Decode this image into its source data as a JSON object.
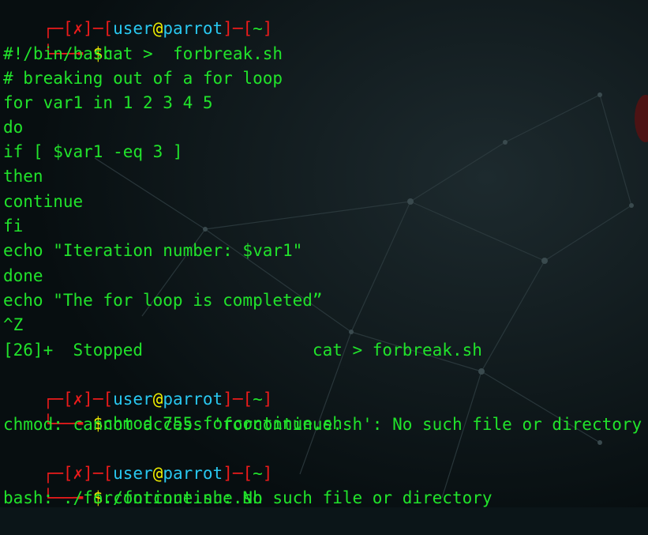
{
  "prompts": [
    {
      "user": "user",
      "at": "@",
      "host": "parrot",
      "dir": "~",
      "status_mark": "✗",
      "dollar": "$",
      "command": "cat >  forbreak.sh"
    },
    {
      "user": "user",
      "at": "@",
      "host": "parrot",
      "dir": "~",
      "status_mark": "✗",
      "dollar": "$",
      "command": "chmod 755 forcontinue.sh"
    },
    {
      "user": "user",
      "at": "@",
      "host": "parrot",
      "dir": "~",
      "status_mark": "✗",
      "dollar": "$",
      "command": "./forcontinue.sh"
    }
  ],
  "script_lines": [
    "#!/bin/bash",
    "# breaking out of a for loop",
    "for var1 in 1 2 3 4 5",
    "do",
    "if [ $var1 -eq 3 ]",
    "then",
    "continue",
    "fi",
    "echo \"Iteration number: $var1\"",
    "done",
    "echo \"The for loop is completed”",
    "^Z"
  ],
  "job_stopped": "[26]+  Stopped                 cat > forbreak.sh",
  "chmod_error": "chmod: cannot access 'forcontinue.sh': No such file or directory",
  "bash_error": "bash: ./forcontinue.sh: No such file or directory",
  "colors": {
    "output_green": "#21e32b",
    "prompt_red": "#ec1b1b",
    "user_cyan": "#28c7ef",
    "at_yellow": "#f0f000",
    "background": "#0b1518"
  }
}
